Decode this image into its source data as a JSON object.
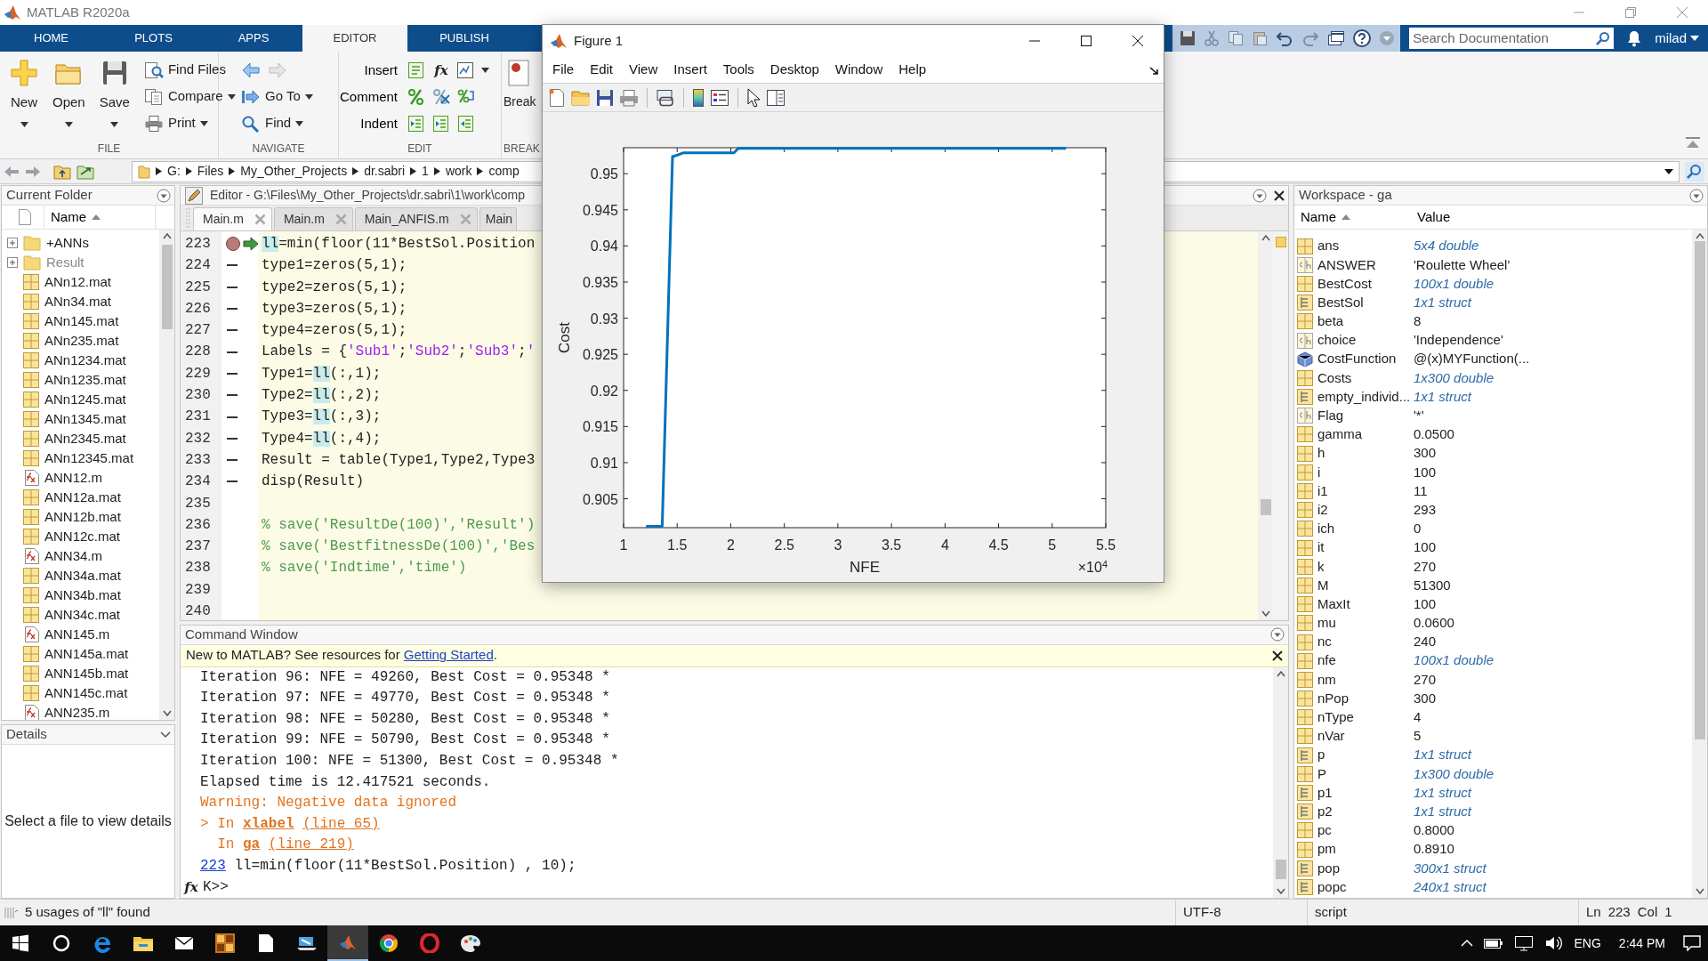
{
  "window": {
    "title": "MATLAB R2020a"
  },
  "ribbon_tabs": [
    {
      "label": "HOME",
      "selected": false
    },
    {
      "label": "PLOTS",
      "selected": false
    },
    {
      "label": "APPS",
      "selected": false
    },
    {
      "label": "EDITOR",
      "selected": true
    },
    {
      "label": "PUBLISH",
      "selected": false
    }
  ],
  "search": {
    "placeholder": "Search Documentation"
  },
  "user": "milad",
  "ribbon": {
    "sections": [
      {
        "label": "FILE",
        "large": [
          {
            "label": "New",
            "caret": true
          },
          {
            "label": "Open",
            "caret": true
          },
          {
            "label": "Save",
            "caret": true
          }
        ],
        "small": [
          {
            "label": "Find Files",
            "caret": false
          },
          {
            "label": "Compare",
            "caret": true
          },
          {
            "label": "Print",
            "caret": true
          }
        ]
      },
      {
        "label": "NAVIGATE",
        "small": [
          {
            "label": "Go To",
            "caret": true
          },
          {
            "label": "Find",
            "caret": true
          }
        ]
      },
      {
        "label": "EDIT",
        "rows": [
          {
            "label": "Insert"
          },
          {
            "label": "Comment"
          },
          {
            "label": "Indent"
          }
        ],
        "function_glyph": "fx"
      },
      {
        "label": "BREAK",
        "large": [
          {
            "label": "Break",
            "caret": false
          }
        ]
      }
    ]
  },
  "address": {
    "path": [
      "G:",
      "Files",
      "My_Other_Projects",
      "dr.sabri",
      "1",
      "work",
      "comp"
    ]
  },
  "folder": {
    "title": "Current Folder",
    "column": "Name",
    "items": [
      {
        "name": "+ANNs",
        "kind": "folder",
        "dimmed": false
      },
      {
        "name": "Result",
        "kind": "folder",
        "dimmed": true
      },
      {
        "name": "ANn12.mat",
        "kind": "mat",
        "dimmed": false
      },
      {
        "name": "ANn34.mat",
        "kind": "mat",
        "dimmed": false
      },
      {
        "name": "ANn145.mat",
        "kind": "mat",
        "dimmed": false
      },
      {
        "name": "ANn235.mat",
        "kind": "mat",
        "dimmed": false
      },
      {
        "name": "ANn1234.mat",
        "kind": "mat",
        "dimmed": false
      },
      {
        "name": "ANn1235.mat",
        "kind": "mat",
        "dimmed": false
      },
      {
        "name": "ANn1245.mat",
        "kind": "mat",
        "dimmed": false
      },
      {
        "name": "ANn1345.mat",
        "kind": "mat",
        "dimmed": false
      },
      {
        "name": "ANn2345.mat",
        "kind": "mat",
        "dimmed": false
      },
      {
        "name": "ANn12345.mat",
        "kind": "mat",
        "dimmed": false
      },
      {
        "name": "ANN12.m",
        "kind": "mfile",
        "dimmed": false
      },
      {
        "name": "ANN12a.mat",
        "kind": "mat",
        "dimmed": false
      },
      {
        "name": "ANN12b.mat",
        "kind": "mat",
        "dimmed": false
      },
      {
        "name": "ANN12c.mat",
        "kind": "mat",
        "dimmed": false
      },
      {
        "name": "ANN34.m",
        "kind": "mfile",
        "dimmed": false
      },
      {
        "name": "ANN34a.mat",
        "kind": "mat",
        "dimmed": false
      },
      {
        "name": "ANN34b.mat",
        "kind": "mat",
        "dimmed": false
      },
      {
        "name": "ANN34c.mat",
        "kind": "mat",
        "dimmed": false
      },
      {
        "name": "ANN145.m",
        "kind": "mfile",
        "dimmed": false
      },
      {
        "name": "ANN145a.mat",
        "kind": "mat",
        "dimmed": false
      },
      {
        "name": "ANN145b.mat",
        "kind": "mat",
        "dimmed": false
      },
      {
        "name": "ANN145c.mat",
        "kind": "mat",
        "dimmed": false
      },
      {
        "name": "ANN235.m",
        "kind": "mfile",
        "dimmed": false
      }
    ]
  },
  "details": {
    "title": "Details",
    "message": "Select a file to view details"
  },
  "editor": {
    "title": "Editor - G:\\Files\\My_Other_Projects\\dr.sabri\\1\\work\\comp",
    "tabs": [
      {
        "label": "Main.m",
        "selected": true
      },
      {
        "label": "Main.m",
        "selected": false
      },
      {
        "label": "Main_ANFIS.m",
        "selected": false
      },
      {
        "label": "Main",
        "selected": false
      }
    ],
    "lines": [
      {
        "number": "223",
        "breakpoint": true,
        "current": true,
        "executable": false,
        "segments": [
          {
            "kind": "match",
            "text": "ll"
          },
          {
            "kind": "code",
            "text": "=min(floor(11*BestSol.Position"
          }
        ]
      },
      {
        "number": "224",
        "breakpoint": false,
        "current": false,
        "executable": true,
        "segments": [
          {
            "kind": "code",
            "text": "type1=zeros(5,1);"
          }
        ]
      },
      {
        "number": "225",
        "breakpoint": false,
        "current": false,
        "executable": true,
        "segments": [
          {
            "kind": "code",
            "text": "type2=zeros(5,1);"
          }
        ]
      },
      {
        "number": "226",
        "breakpoint": false,
        "current": false,
        "executable": true,
        "segments": [
          {
            "kind": "code",
            "text": "type3=zeros(5,1);"
          }
        ]
      },
      {
        "number": "227",
        "breakpoint": false,
        "current": false,
        "executable": true,
        "segments": [
          {
            "kind": "code",
            "text": "type4=zeros(5,1);"
          }
        ]
      },
      {
        "number": "228",
        "breakpoint": false,
        "current": false,
        "executable": true,
        "segments": [
          {
            "kind": "code",
            "text": "Labels = {"
          },
          {
            "kind": "string",
            "text": "'Sub1'"
          },
          {
            "kind": "code",
            "text": ";"
          },
          {
            "kind": "string",
            "text": "'Sub2'"
          },
          {
            "kind": "code",
            "text": ";"
          },
          {
            "kind": "string",
            "text": "'Sub3'"
          },
          {
            "kind": "code",
            "text": ";"
          },
          {
            "kind": "string",
            "text": "'"
          }
        ]
      },
      {
        "number": "229",
        "breakpoint": false,
        "current": false,
        "executable": true,
        "segments": [
          {
            "kind": "code",
            "text": "Type1="
          },
          {
            "kind": "match",
            "text": "ll"
          },
          {
            "kind": "code",
            "text": "(:,1);"
          }
        ]
      },
      {
        "number": "230",
        "breakpoint": false,
        "current": false,
        "executable": true,
        "segments": [
          {
            "kind": "code",
            "text": "Type2="
          },
          {
            "kind": "match",
            "text": "ll"
          },
          {
            "kind": "code",
            "text": "(:,2);"
          }
        ]
      },
      {
        "number": "231",
        "breakpoint": false,
        "current": false,
        "executable": true,
        "segments": [
          {
            "kind": "code",
            "text": "Type3="
          },
          {
            "kind": "match",
            "text": "ll"
          },
          {
            "kind": "code",
            "text": "(:,3);"
          }
        ]
      },
      {
        "number": "232",
        "breakpoint": false,
        "current": false,
        "executable": true,
        "segments": [
          {
            "kind": "code",
            "text": "Type4="
          },
          {
            "kind": "match",
            "text": "ll"
          },
          {
            "kind": "code",
            "text": "(:,4);"
          }
        ]
      },
      {
        "number": "233",
        "breakpoint": false,
        "current": false,
        "executable": true,
        "segments": [
          {
            "kind": "code",
            "text": "Result = table(Type1,Type2,Type3"
          }
        ]
      },
      {
        "number": "234",
        "breakpoint": false,
        "current": false,
        "executable": true,
        "segments": [
          {
            "kind": "code",
            "text": "disp(Result)"
          }
        ]
      },
      {
        "number": "235",
        "breakpoint": false,
        "current": false,
        "executable": false
      },
      {
        "number": "236",
        "breakpoint": false,
        "current": false,
        "executable": false,
        "segments": [
          {
            "kind": "comment",
            "text": "% save('ResultDe(100)','Result')"
          }
        ]
      },
      {
        "number": "237",
        "breakpoint": false,
        "current": false,
        "executable": false,
        "segments": [
          {
            "kind": "comment",
            "text": "% save('BestfitnessDe(100)','Bes"
          }
        ]
      },
      {
        "number": "238",
        "breakpoint": false,
        "current": false,
        "executable": false,
        "segments": [
          {
            "kind": "comment",
            "text": "% save('Indtime','time')"
          }
        ]
      },
      {
        "number": "239",
        "breakpoint": false,
        "current": false,
        "executable": false
      },
      {
        "number": "240",
        "breakpoint": false,
        "current": false,
        "executable": false
      }
    ]
  },
  "command_window": {
    "title": "Command Window",
    "banner": {
      "text": "New to MATLAB? See resources for ",
      "link": "Getting Started",
      "after": "."
    },
    "lines": [
      {
        "kind": "output",
        "text": "Iteration 96: NFE = 49260, Best Cost = 0.95348 *"
      },
      {
        "kind": "output",
        "text": "Iteration 97: NFE = 49770, Best Cost = 0.95348 *"
      },
      {
        "kind": "output",
        "text": "Iteration 98: NFE = 50280, Best Cost = 0.95348 *"
      },
      {
        "kind": "output",
        "text": "Iteration 99: NFE = 50790, Best Cost = 0.95348 *"
      },
      {
        "kind": "output",
        "text": "Iteration 100: NFE = 51300, Best Cost = 0.95348 *"
      },
      {
        "kind": "output",
        "text": "Elapsed time is 12.417521 seconds."
      },
      {
        "kind": "warning",
        "text": "Warning: Negative data ignored"
      },
      {
        "kind": "stack",
        "segments": [
          {
            "kind": "text",
            "text": "> In "
          },
          {
            "kind": "bold_link",
            "text": "xlabel"
          },
          {
            "kind": "link",
            "text": "(line 65)"
          }
        ]
      },
      {
        "kind": "stack",
        "segments": [
          {
            "kind": "text",
            "text": "  In "
          },
          {
            "kind": "bold_link",
            "text": "ga"
          },
          {
            "kind": "link",
            "text": "(line 219)"
          }
        ]
      },
      {
        "kind": "echo",
        "segments": [
          {
            "kind": "link",
            "text": "223"
          },
          {
            "kind": "text",
            "text": " ll=min(floor(11*BestSol.Position) , 10);"
          }
        ]
      }
    ],
    "prompt": {
      "glyph": "fx",
      "text": "K>>"
    }
  },
  "workspace": {
    "title": "Workspace - ga",
    "columns": [
      "Name",
      "Value"
    ],
    "rows": [
      {
        "name": "ans",
        "value": "5x4 double",
        "kind": "matrix",
        "summary": true
      },
      {
        "name": "ANSWER",
        "value": "'Roulette Wheel'",
        "kind": "char",
        "summary": false
      },
      {
        "name": "BestCost",
        "value": "100x1 double",
        "kind": "matrix",
        "summary": true
      },
      {
        "name": "BestSol",
        "value": "1x1 struct",
        "kind": "struct",
        "summary": true
      },
      {
        "name": "beta",
        "value": "8",
        "kind": "matrix",
        "summary": false
      },
      {
        "name": "choice",
        "value": "'Independence'",
        "kind": "char",
        "summary": false
      },
      {
        "name": "CostFunction",
        "value": "@(x)MYFunction(...",
        "kind": "handle",
        "summary": false
      },
      {
        "name": "Costs",
        "value": "1x300 double",
        "kind": "matrix",
        "summary": true
      },
      {
        "name": "empty_individ...",
        "value": "1x1 struct",
        "kind": "struct",
        "summary": true
      },
      {
        "name": "Flag",
        "value": "'*'",
        "kind": "char",
        "summary": false
      },
      {
        "name": "gamma",
        "value": "0.0500",
        "kind": "matrix",
        "summary": false
      },
      {
        "name": "h",
        "value": "300",
        "kind": "matrix",
        "summary": false
      },
      {
        "name": "i",
        "value": "100",
        "kind": "matrix",
        "summary": false
      },
      {
        "name": "i1",
        "value": "11",
        "kind": "matrix",
        "summary": false
      },
      {
        "name": "i2",
        "value": "293",
        "kind": "matrix",
        "summary": false
      },
      {
        "name": "ich",
        "value": "0",
        "kind": "matrix",
        "summary": false
      },
      {
        "name": "it",
        "value": "100",
        "kind": "matrix",
        "summary": false
      },
      {
        "name": "k",
        "value": "270",
        "kind": "matrix",
        "summary": false
      },
      {
        "name": "M",
        "value": "51300",
        "kind": "matrix",
        "summary": false
      },
      {
        "name": "MaxIt",
        "value": "100",
        "kind": "matrix",
        "summary": false
      },
      {
        "name": "mu",
        "value": "0.0600",
        "kind": "matrix",
        "summary": false
      },
      {
        "name": "nc",
        "value": "240",
        "kind": "matrix",
        "summary": false
      },
      {
        "name": "nfe",
        "value": "100x1 double",
        "kind": "matrix",
        "summary": true
      },
      {
        "name": "nm",
        "value": "270",
        "kind": "matrix",
        "summary": false
      },
      {
        "name": "nPop",
        "value": "300",
        "kind": "matrix",
        "summary": false
      },
      {
        "name": "nType",
        "value": "4",
        "kind": "matrix",
        "summary": false
      },
      {
        "name": "nVar",
        "value": "5",
        "kind": "matrix",
        "summary": false
      },
      {
        "name": "p",
        "value": "1x1 struct",
        "kind": "struct",
        "summary": true
      },
      {
        "name": "P",
        "value": "1x300 double",
        "kind": "matrix",
        "summary": true
      },
      {
        "name": "p1",
        "value": "1x1 struct",
        "kind": "struct",
        "summary": true
      },
      {
        "name": "p2",
        "value": "1x1 struct",
        "kind": "struct",
        "summary": true
      },
      {
        "name": "pc",
        "value": "0.8000",
        "kind": "matrix",
        "summary": false
      },
      {
        "name": "pm",
        "value": "0.8910",
        "kind": "matrix",
        "summary": false
      },
      {
        "name": "pop",
        "value": "300x1 struct",
        "kind": "struct",
        "summary": true
      },
      {
        "name": "popc",
        "value": "240x1 struct",
        "kind": "struct",
        "summary": true
      }
    ]
  },
  "status_bar": {
    "message": "5 usages of \"ll\" found",
    "encoding": "UTF-8",
    "file_type": "script",
    "ln_label": "Ln",
    "ln": "223",
    "col_label": "Col",
    "col": "1"
  },
  "taskbar": {
    "apps": [
      {
        "selected": false
      },
      {
        "selected": false
      },
      {
        "selected": false
      },
      {
        "selected": false
      },
      {
        "selected": false
      },
      {
        "selected": false
      },
      {
        "selected": true
      },
      {
        "selected": false
      },
      {
        "selected": false
      },
      {
        "selected": false
      }
    ],
    "language": "ENG",
    "time": "2:44 PM"
  },
  "figure": {
    "title": "Figure 1",
    "menu": [
      "File",
      "Edit",
      "View",
      "Insert",
      "Tools",
      "Desktop",
      "Window",
      "Help"
    ],
    "x_multiplier": "×10$^{4}$",
    "chart_data": {
      "type": "line",
      "xlabel": "NFE",
      "ylabel": "Cost",
      "xlim": [
        1,
        5.5
      ],
      "ylim": [
        0.901,
        0.9536
      ],
      "xticks": [
        1,
        1.5,
        2,
        2.5,
        3,
        3.5,
        4,
        4.5,
        5,
        5.5
      ],
      "yticks": [
        0.905,
        0.91,
        0.915,
        0.92,
        0.925,
        0.93,
        0.935,
        0.94,
        0.945,
        0.95
      ],
      "x": [
        1.21,
        1.36,
        1.457,
        1.47,
        1.56,
        2.03,
        2.07,
        5.13
      ],
      "series": [
        {
          "color": "#0072bd",
          "values": [
            0.9012,
            0.9012,
            0.9524,
            0.9524,
            0.9529,
            0.9529,
            0.9535,
            0.9535
          ]
        }
      ]
    }
  }
}
